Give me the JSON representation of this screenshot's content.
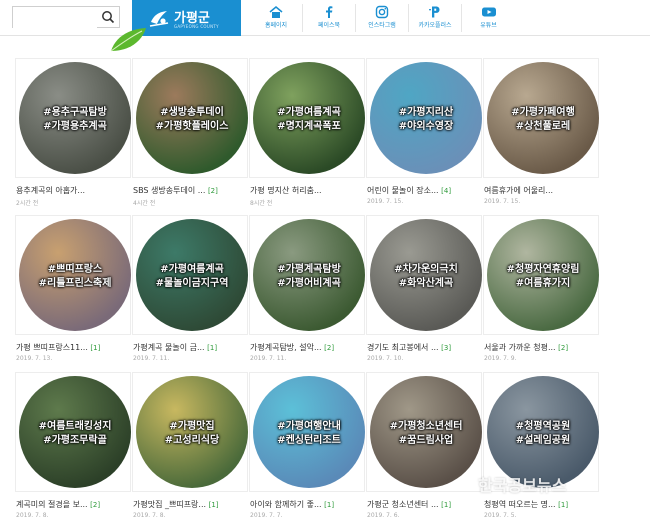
{
  "header": {
    "search": {
      "value": "",
      "placeholder": ""
    },
    "logo": {
      "text": "가평군",
      "subtext": "GAPYEONG COUNTY"
    },
    "nav": [
      {
        "label": "홈페이지",
        "icon": "home-icon"
      },
      {
        "label": "페이스북",
        "icon": "facebook-icon"
      },
      {
        "label": "인스타그램",
        "icon": "instagram-icon"
      },
      {
        "label": "카카오플러스",
        "icon": "kakao-plus-icon"
      },
      {
        "label": "유튜브",
        "icon": "youtube-icon"
      }
    ]
  },
  "cards": [
    {
      "tag1": "#용추구곡탐방",
      "tag2": "#가평용추계곡",
      "title": "용추계곡의 아홉가...",
      "count": "",
      "date": "2시간 전",
      "colors": [
        "#4a4f46",
        "#8a8d86"
      ]
    },
    {
      "tag1": "#생방송투데이",
      "tag2": "#가평핫플레이스",
      "title": "SBS 생방송투데이 ...",
      "count": "[2]",
      "date": "4시간 전",
      "colors": [
        "#2f5a2c",
        "#9c7a5c"
      ]
    },
    {
      "tag1": "#가평여름계곡",
      "tag2": "#명지계곡폭포",
      "title": "가평 명지산 허리춤...",
      "count": "",
      "date": "8시간 전",
      "colors": [
        "#2b4a26",
        "#7fa15e"
      ]
    },
    {
      "tag1": "#가평지리산",
      "tag2": "#야외수영장",
      "title": "어린이 물놀이 장소...",
      "count": "[4]",
      "date": "2019. 7. 15.",
      "colors": [
        "#6a90b8",
        "#4fa6c4"
      ]
    },
    {
      "tag1": "#가평카페여행",
      "tag2": "#상천풀로레",
      "title": "여름휴가에 어울리...",
      "count": "",
      "date": "2019. 7. 15.",
      "colors": [
        "#6a5a48",
        "#b8a890"
      ]
    },
    {
      "tag1": "#쁘띠프랑스",
      "tag2": "#리틀프린스축제",
      "title": "가평 쁘띠프랑스11...",
      "count": "[1]",
      "date": "2019. 7. 13.",
      "colors": [
        "#7a6a78",
        "#c8a070"
      ]
    },
    {
      "tag1": "#가평여름계곡",
      "tag2": "#물놀이금지구역",
      "title": "가평계곡 물놀이 금...",
      "count": "[1]",
      "date": "2019. 7. 11.",
      "colors": [
        "#2e4a36",
        "#3d7a68"
      ]
    },
    {
      "tag1": "#가평계곡탐방",
      "tag2": "#가평어비계곡",
      "title": "가평계곡탐방, 설악...",
      "count": "[2]",
      "date": "2019. 7. 11.",
      "colors": [
        "#3c5a32",
        "#8a9a80"
      ]
    },
    {
      "tag1": "#차가운의극치",
      "tag2": "#화악산계곡",
      "title": "경기도 최고봉에서 ...",
      "count": "[3]",
      "date": "2019. 7. 10.",
      "colors": [
        "#5a5a56",
        "#9a9a92"
      ]
    },
    {
      "tag1": "#청평자연휴양림",
      "tag2": "#여름휴가지",
      "title": "서울과 가까운 청평...",
      "count": "[2]",
      "date": "2019. 7. 9.",
      "colors": [
        "#4a6a42",
        "#b0b6a0"
      ]
    },
    {
      "tag1": "#여름트래킹성지",
      "tag2": "#가평조무락골",
      "title": "계곡미의 절경을 보...",
      "count": "[2]",
      "date": "2019. 7. 8.",
      "colors": [
        "#2c4028",
        "#5e7a4c"
      ]
    },
    {
      "tag1": "#가평맛집",
      "tag2": "#고성리식당",
      "title": "가평맛집 _쁘띠프랑...",
      "count": "[1]",
      "date": "2019. 7. 8.",
      "colors": [
        "#4a6a3a",
        "#c8b860"
      ]
    },
    {
      "tag1": "#가평여행안내",
      "tag2": "#켄싱턴리조트",
      "title": "아이와 함께하기 좋...",
      "count": "[1]",
      "date": "2019. 7. 7.",
      "colors": [
        "#5a8ab8",
        "#5cc0d8"
      ]
    },
    {
      "tag1": "#가평청소년센터",
      "tag2": "#꿈드림사업",
      "title": "가평군 청소년센터 ...",
      "count": "[1]",
      "date": "2019. 7. 6.",
      "colors": [
        "#5a5048",
        "#a09888"
      ]
    },
    {
      "tag1": "#청평역공원",
      "tag2": "#설레임공원",
      "title": "청평역 떠오르는 명...",
      "count": "[1]",
      "date": "2019. 7. 5.",
      "colors": [
        "#4a5a6a",
        "#8a96a0"
      ]
    }
  ],
  "watermark": "한국공보뉴스"
}
